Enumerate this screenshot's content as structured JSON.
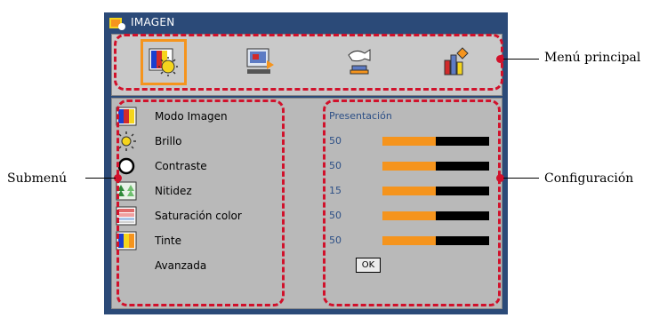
{
  "window": {
    "title": "IMAGEN"
  },
  "main_menu": {
    "items": [
      {
        "icon": "image-menu-icon",
        "selected": true
      },
      {
        "icon": "display-menu-icon",
        "selected": false
      },
      {
        "icon": "setup-menu-icon",
        "selected": false
      },
      {
        "icon": "options-menu-icon",
        "selected": false
      }
    ]
  },
  "submenu": {
    "rows": [
      {
        "icon": "color-bars-icon",
        "label": "Modo Imagen",
        "value": "Presentación"
      },
      {
        "icon": "sun-icon",
        "label": "Brillo",
        "value": "50",
        "level": 0.5
      },
      {
        "icon": "contrast-circle-icon",
        "label": "Contraste",
        "value": "50",
        "level": 0.5
      },
      {
        "icon": "trees-icon",
        "label": "Nitidez",
        "value": "15",
        "level": 0.5
      },
      {
        "icon": "saturation-icon",
        "label": "Saturación color",
        "value": "50",
        "level": 0.5
      },
      {
        "icon": "tint-icon",
        "label": "Tinte",
        "value": "50",
        "level": 0.5
      },
      {
        "icon": "",
        "label": "Avanzada",
        "button": "OK"
      }
    ]
  },
  "callouts": {
    "main_menu": "Menú principal",
    "submenu": "Submenú",
    "settings": "Configuración"
  },
  "colors": {
    "accent": "#f5941d",
    "highlight": "#d1112b",
    "window": "#2b4a78",
    "value_text": "#2c4f86"
  }
}
